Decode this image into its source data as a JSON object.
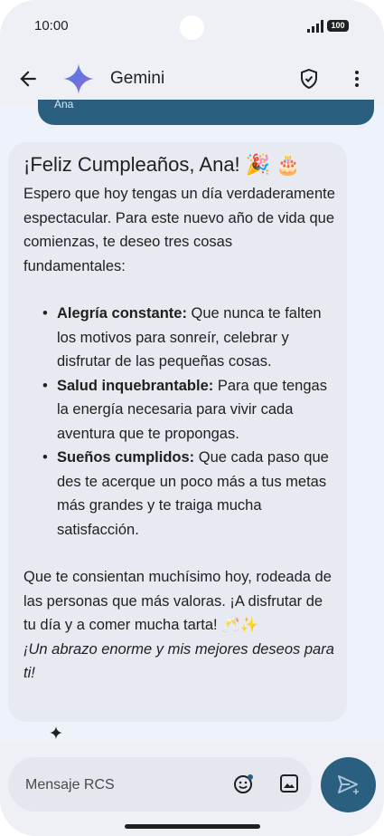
{
  "status": {
    "time": "10:00",
    "battery": "100"
  },
  "appbar": {
    "title": "Gemini"
  },
  "sent": {
    "text": "Ana"
  },
  "message": {
    "title": "¡Feliz Cumpleaños, Ana! 🎉 🎂",
    "intro": "Espero que hoy tengas un día verdaderamente espectacular. Para este nuevo año de vida que comienzas, te deseo tres cosas fundamentales:",
    "items": [
      {
        "bold": "Alegría constante:",
        "text": " Que nunca te falten los motivos para sonreír, celebrar y disfrutar de las pequeñas cosas."
      },
      {
        "bold": "Salud inquebrantable:",
        "text": " Para que tengas la energía necesaria para vivir cada aventura que te propongas."
      },
      {
        "bold": "Sueños cumplidos:",
        "text": " Que cada paso que des te acerque un poco más a tus metas más grandes y te traiga mucha satisfacción."
      }
    ],
    "closing": "Que te consientan muchísimo hoy, rodeada de las personas que más valoras. ¡A disfrutar de tu día y a comer mucha tarta! 🥂✨",
    "signoff": "¡Un abrazo enorme y mis mejores deseos para ti!"
  },
  "compose": {
    "placeholder": "Mensaje RCS"
  },
  "colors": {
    "accent": "#2b5f80",
    "bubble": "#e7eaf1",
    "background": "#eef3fb"
  },
  "icons": [
    "back-arrow-icon",
    "gemini-logo-icon",
    "shield-check-icon",
    "more-vert-icon",
    "sparkle-icon",
    "emoji-icon",
    "gallery-icon",
    "send-icon"
  ]
}
